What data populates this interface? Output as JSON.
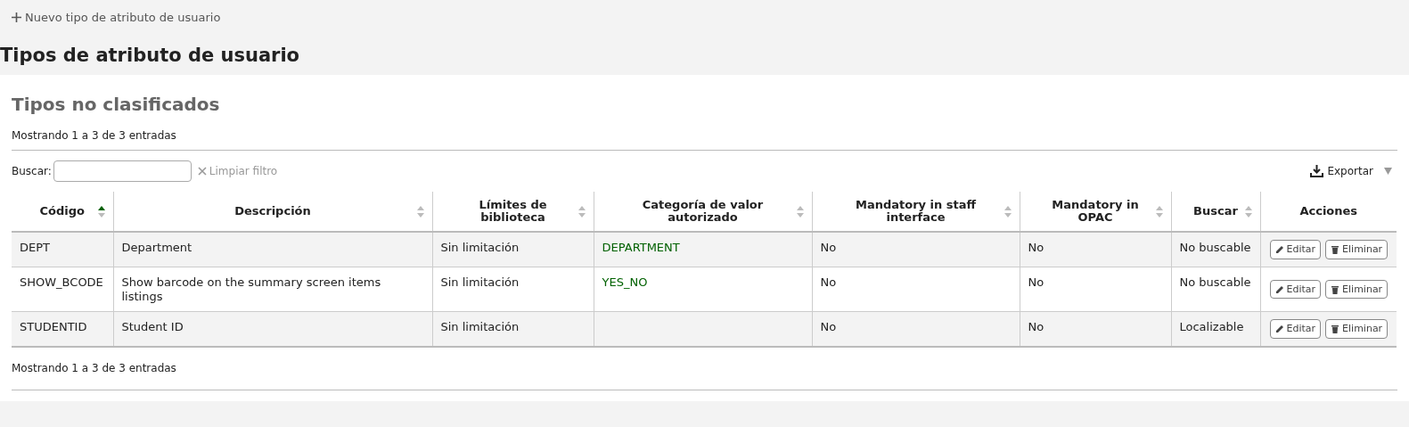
{
  "toolbar": {
    "new_link": "Nuevo tipo de atributo de usuario"
  },
  "title": "Tipos de atributo de usuario",
  "section": {
    "title": "Tipos no clasificados",
    "info_top": "Mostrando 1 a 3 de 3 entradas",
    "info_bottom": "Mostrando 1 a 3 de 3 entradas",
    "search": {
      "label": "Buscar:"
    },
    "clear_filter": "Limpiar filtro",
    "export": "Exportar",
    "table": {
      "columns": [
        {
          "label": "Código",
          "sorted_ascending": true
        },
        {
          "label": "Descripción",
          "sorted_ascending": false
        },
        {
          "label": "Límites de biblioteca",
          "sorted_ascending": false
        },
        {
          "label": "Categoría de valor autorizado",
          "sorted_ascending": false
        },
        {
          "label": "Mandatory in staff interface",
          "sorted_ascending": false
        },
        {
          "label": "Mandatory in OPAC",
          "sorted_ascending": false
        },
        {
          "label": "Buscar",
          "sorted_ascending": false
        },
        {
          "label": "Acciones"
        }
      ],
      "rows": [
        {
          "code": "DEPT",
          "description": "Department",
          "library_limits": "Sin limitación",
          "authorized_value": "DEPARTMENT",
          "mandatory_staff": "No",
          "mandatory_opac": "No",
          "searchable": "No buscable",
          "actions": [
            "Editar",
            "Eliminar"
          ]
        },
        {
          "code": "SHOW_BCODE",
          "description": "Show barcode on the summary screen items listings",
          "library_limits": "Sin limitación",
          "authorized_value": "YES_NO",
          "mandatory_staff": "No",
          "mandatory_opac": "No",
          "searchable": "No buscable",
          "actions": [
            "Editar",
            "Eliminar"
          ]
        },
        {
          "code": "STUDENTID",
          "description": "Student ID",
          "library_limits": "Sin limitación",
          "mandatory_staff": "No",
          "mandatory_opac": "No",
          "searchable": "Localizable",
          "actions": [
            "Editar",
            "Eliminar"
          ]
        }
      ]
    }
  }
}
